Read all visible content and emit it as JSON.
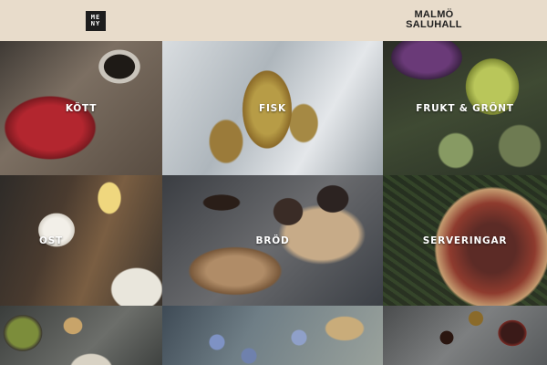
{
  "header": {
    "menu_label_line1": "ME",
    "menu_label_line2": "NY",
    "logo_line1": "MALMÖ",
    "logo_line2": "SALUHALL"
  },
  "categories": [
    {
      "label": "KÖTT"
    },
    {
      "label": "FISK"
    },
    {
      "label": "FRUKT & GRÖNT"
    },
    {
      "label": "OST"
    },
    {
      "label": "BRÖD"
    },
    {
      "label": "SERVERINGAR"
    }
  ],
  "colors": {
    "header_bg": "#e8dccb",
    "menu_button_bg": "#1d1d1d",
    "label_text": "#ffffff"
  }
}
